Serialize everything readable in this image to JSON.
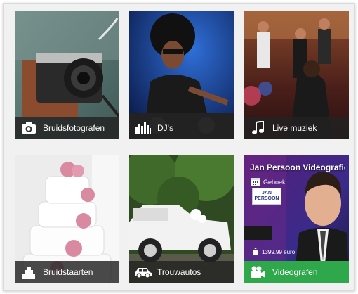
{
  "tiles": [
    {
      "label": "Bruidsfotografen",
      "icon": "camera-icon"
    },
    {
      "label": "DJ's",
      "icon": "equalizer-icon"
    },
    {
      "label": "Live muziek",
      "icon": "music-note-icon"
    },
    {
      "label": "Bruidstaarten",
      "icon": "cake-icon"
    },
    {
      "label": "Trouwautos",
      "icon": "car-icon"
    },
    {
      "label": "Videografen",
      "icon": "video-camera-icon"
    }
  ],
  "promo": {
    "title": "Jan Persoon Videografie en...",
    "status": "Geboekt",
    "logo_line1": "JAN",
    "logo_line2": "PERSOON",
    "price": "1399.99 euro"
  },
  "colors": {
    "bar_dark": "#222222",
    "bar_green": "#2ea84a"
  }
}
